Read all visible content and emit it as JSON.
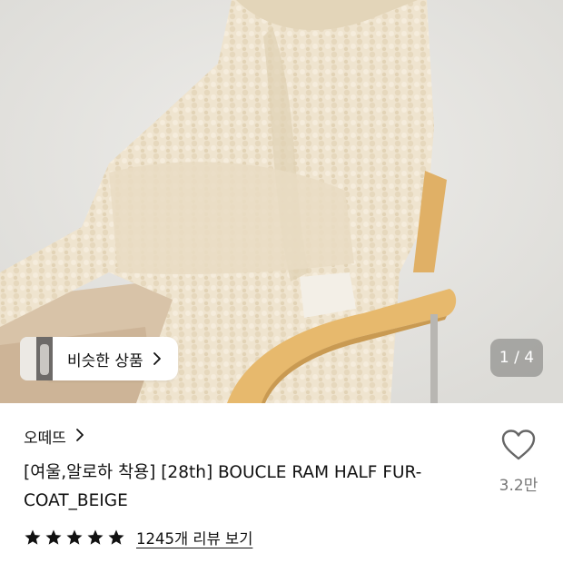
{
  "hero": {
    "similar_button_label": "비슷한 상품",
    "pager_text": "1 / 4"
  },
  "product": {
    "brand": "오떼뜨",
    "title": "[여울,알로하 착용] [28th] BOUCLE RAM HALF FUR-COAT_BEIGE",
    "like_count": "3.2만",
    "rating_stars": 5,
    "review_link": "1245개 리뷰 보기"
  },
  "colors": {
    "coat": "#efe3cc",
    "chair_wood": "#e3b56a",
    "background_wall": "#e7e6e2",
    "star": "#111111"
  },
  "icons": {
    "chevron": "chevron-right-icon",
    "heart": "heart-outline-icon",
    "star": "star-filled-icon"
  }
}
